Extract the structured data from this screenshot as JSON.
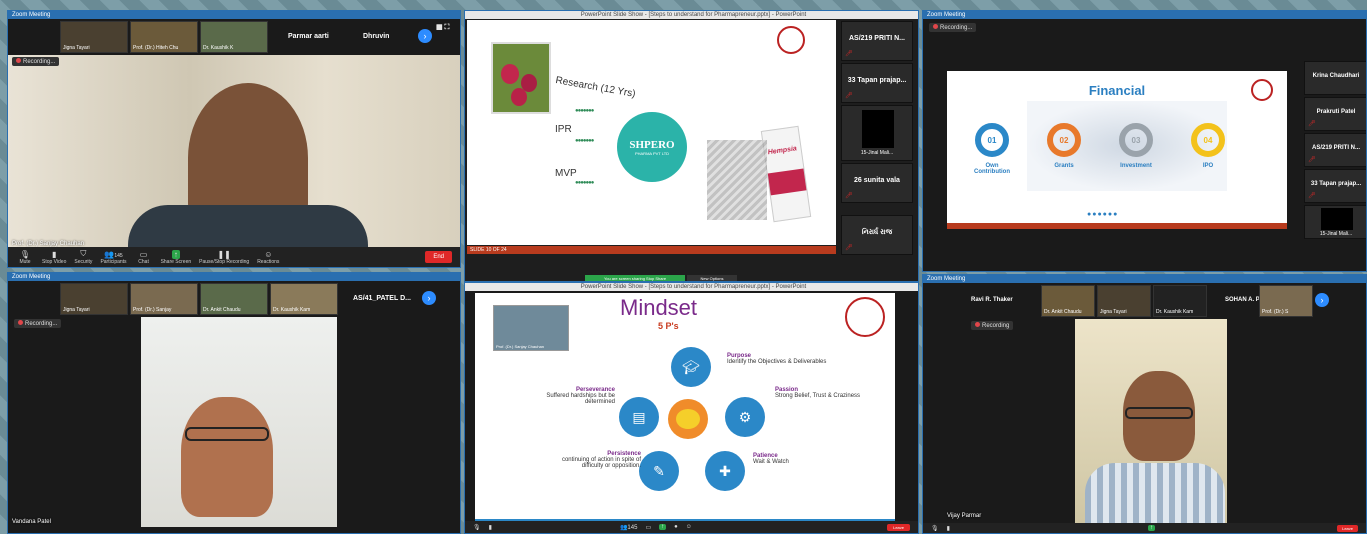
{
  "p1": {
    "window_title": "Zoom Meeting",
    "thumbs": [
      "Jigna Tayari",
      "Prof. (Dr.) Hiteh Chu",
      "Dr. Kaushik K"
    ],
    "names": [
      "Parmar aarti",
      "Dhruvin"
    ],
    "recording": "Recording...",
    "speaker": "Prof. (Dr.) Sanjay Chauhan",
    "controls": [
      "Mute",
      "Stop Video",
      "Security",
      "Participants",
      "Chat",
      "Share Screen",
      "Pause/Stop Recording",
      "Reactions"
    ],
    "participants_count": "145",
    "end": "End"
  },
  "p2": {
    "window_title": "PowerPoint Slide Show - [Steps to understand for Pharmapreneur.pptx] - PowerPoint",
    "labels": [
      "Research (12 Yrs)",
      "IPR",
      "MVP"
    ],
    "logo": "SHPERO",
    "logo_sub": "PHARMA PVT LTD",
    "product": "Hempsia",
    "side": [
      "AS/219 PRITI N...",
      "33 Tapan prajap...",
      "15-Jinal Mali...",
      "26 sunita vala",
      "નિરાર્ધ રાજ"
    ],
    "footer": "SLIDE 10 OF 24",
    "share_banner": "You are screen sharing   Stop Share",
    "new_options": "New Options"
  },
  "p3": {
    "window_title": "Zoom Meeting",
    "recording": "Recording...",
    "slide_title": "Financial",
    "steps": [
      {
        "num": "01",
        "label": "Own Contribution",
        "color": "#2b88c8"
      },
      {
        "num": "02",
        "label": "Grants",
        "color": "#e8792b"
      },
      {
        "num": "03",
        "label": "Investment",
        "color": "#9aa3ab"
      },
      {
        "num": "04",
        "label": "IPO",
        "color": "#f3c21b"
      }
    ],
    "side": [
      "Krina Chaudhari",
      "Prakruti Patel",
      "AS/219 PRITI N...",
      "33 Tapan prajap...",
      "15-Jinal Mali..."
    ]
  },
  "p4": {
    "window_title": "Zoom Meeting",
    "thumbs": [
      "Jigna Tayari",
      "Prof. (Dr.) Sanjay",
      "Dr. Ankit Chaudu",
      "Dr. Kaushik Kam"
    ],
    "name": "AS/41_PATEL D...",
    "recording": "Recording...",
    "speaker": "Vandana Patel"
  },
  "p5": {
    "window_title": "PowerPoint Slide Show - [Steps to understand for Pharmapreneur.pptx] - PowerPoint",
    "title": "Mindset",
    "subtitle": "5 P's",
    "presenter": "Prof. (Dr.) Sanjay Chauhan",
    "items": [
      {
        "head": "Purpose",
        "text": "Identify the Objectives & Deliverables"
      },
      {
        "head": "Passion",
        "text": "Strong Belief, Trust & Craziness"
      },
      {
        "head": "Patience",
        "text": "Wait & Watch"
      },
      {
        "head": "Persistence",
        "text": "continuing of action in spite of difficulty or opposition."
      },
      {
        "head": "Perseverance",
        "text": "Suffered hardships but be determined"
      }
    ],
    "count": "145",
    "end": "Leave"
  },
  "p6": {
    "window_title": "Zoom Meeting",
    "names": [
      "Ravi R. Thaker",
      "SOHAN A. PATEL"
    ],
    "thumbs": [
      "Dr. Ankit Chaudu",
      "Jigna Tayari",
      "Dr. Kaushik Kam",
      "Prof. (Dr.) S"
    ],
    "recording": "Recording",
    "speaker": "Vijay Parmar",
    "end": "Leave"
  }
}
